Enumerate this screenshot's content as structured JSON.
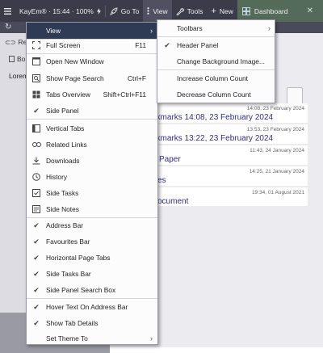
{
  "topbar": {
    "status": "KayEm® · 15:44 · 100%",
    "goto": "Go To",
    "view": "View",
    "tools": "Tools",
    "new": "New",
    "dashboard": "Dashboard"
  },
  "leftstrip": {
    "item1": "Re",
    "item2": "Bo",
    "lorem": "Lorem"
  },
  "cards": [
    {
      "stamp": "14:08, 23 February 2024",
      "title": "okmarks 14:08, 23 February 2024"
    },
    {
      "stamp": "13:53, 23 February 2024",
      "title": "okmarks 13:22, 23 February 2024"
    },
    {
      "stamp": "11:43, 24 January 2024",
      "title": "Paper"
    },
    {
      "stamp": "14:25, 21 January 2024",
      "title": "es"
    },
    {
      "stamp": "19:34, 01 August 2021",
      "title": "ocument"
    }
  ],
  "menu": {
    "view": "View",
    "full_screen": "Full Screen",
    "full_screen_sc": "F11",
    "open_new_window": "Open New Window",
    "show_page_search": "Show Page Search",
    "show_page_search_sc": "Ctrl+F",
    "tabs_overview": "Tabs Overview",
    "tabs_overview_sc": "Shift+Ctrl+F11",
    "side_panel": "Side Panel",
    "vertical_tabs": "Vertical Tabs",
    "related_links": "Related Links",
    "downloads": "Downloads",
    "history": "History",
    "side_tasks": "Side Tasks",
    "side_notes": "Side Notes",
    "address_bar": "Address Bar",
    "favourites_bar": "Favourites Bar",
    "horizontal_page_tabs": "Horizontal Page Tabs",
    "side_tasks_bar": "Side Tasks Bar",
    "side_panel_search_box": "Side Panel Search Box",
    "hover_text": "Hover Text On Address Bar",
    "show_tab_details": "Show Tab Details",
    "set_theme": "Set Theme To"
  },
  "submenu": {
    "toolbars": "Toolbars",
    "header_panel": "Header Panel",
    "change_bg": "Change Background Image...",
    "increase_cols": "Increase Column Count",
    "decrease_cols": "Decrease Column Count"
  }
}
